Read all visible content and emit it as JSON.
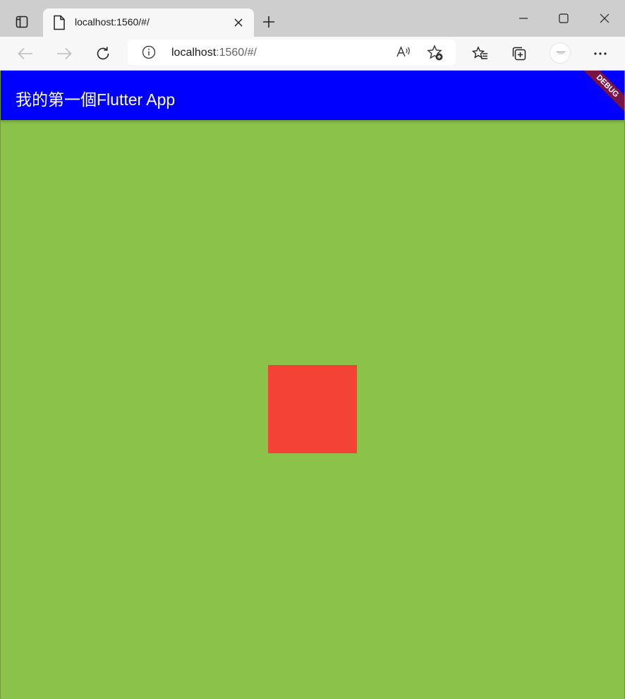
{
  "browser": {
    "tab": {
      "title": "localhost:1560/#/"
    },
    "address": {
      "host": "localhost",
      "rest": ":1560/#/"
    }
  },
  "app": {
    "appbar_title": "我的第一個Flutter App",
    "debug_label": "DEBUG",
    "colors": {
      "appbar": "#0000ff",
      "background": "#8bc34a",
      "box": "#f44336",
      "debug": "#7a1446"
    }
  }
}
